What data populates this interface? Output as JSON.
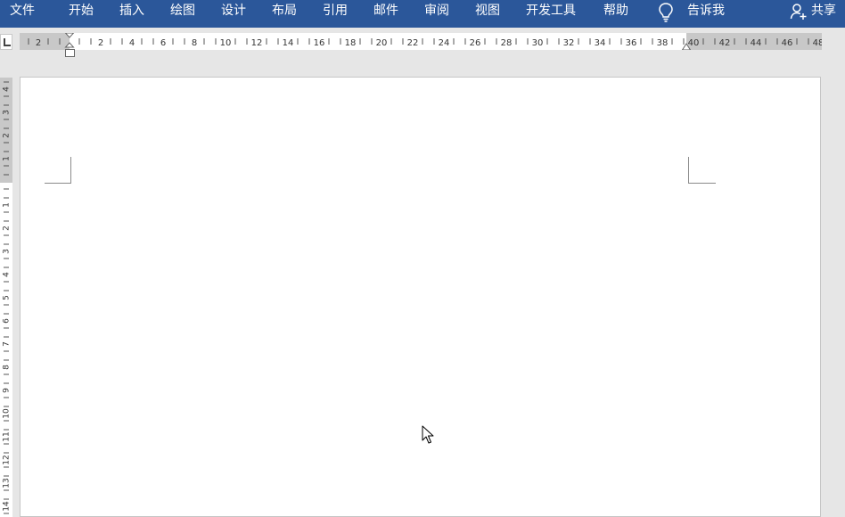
{
  "ribbon": {
    "background": "#2b579a",
    "tabs": [
      {
        "id": "file",
        "label": "文件"
      },
      {
        "id": "home",
        "label": "开始"
      },
      {
        "id": "insert",
        "label": "插入"
      },
      {
        "id": "draw",
        "label": "绘图"
      },
      {
        "id": "design",
        "label": "设计"
      },
      {
        "id": "layout",
        "label": "布局"
      },
      {
        "id": "references",
        "label": "引用"
      },
      {
        "id": "mailings",
        "label": "邮件"
      },
      {
        "id": "review",
        "label": "审阅"
      },
      {
        "id": "view",
        "label": "视图"
      },
      {
        "id": "developer",
        "label": "开发工具"
      },
      {
        "id": "help",
        "label": "帮助"
      }
    ],
    "tell_me": {
      "label": "告诉我",
      "icon": "lightbulb-icon"
    },
    "share": {
      "label": "共享",
      "icon": "person-add-icon"
    }
  },
  "ruler": {
    "horizontal_labels": [
      "2",
      "",
      "2",
      "4",
      "6",
      "8",
      "10",
      "12",
      "14",
      "16",
      "18",
      "20",
      "22",
      "24",
      "26",
      "28",
      "30",
      "32",
      "34",
      "36",
      "38",
      "40",
      "42",
      "44",
      "46",
      "48"
    ],
    "vertical_labels": [
      "4",
      "3",
      "2",
      "1",
      "",
      "1",
      "2",
      "3",
      "4",
      "5",
      "6",
      "7",
      "8",
      "9",
      "10",
      "11",
      "12",
      "13",
      "14"
    ]
  },
  "document": {
    "page_background": "#ffffff"
  }
}
